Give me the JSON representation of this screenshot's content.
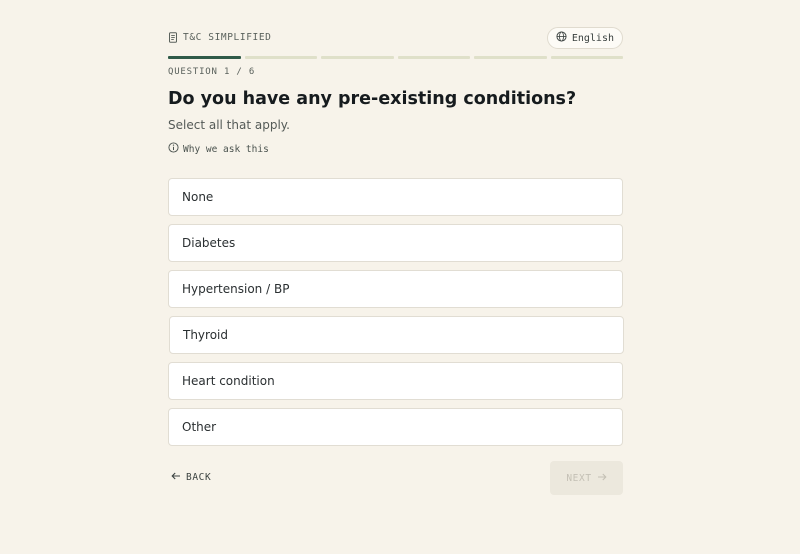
{
  "header": {
    "brand_label": "T&C SIMPLIFIED",
    "brand_icon": "scroll-icon",
    "language_label": "English",
    "language_icon": "globe-icon"
  },
  "progress": {
    "current_step": 1,
    "total_steps": 6
  },
  "question": {
    "counter": "QUESTION 1 / 6",
    "title": "Do you have any pre-existing conditions?",
    "subtitle": "Select all that apply.",
    "why_link": "Why we ask this",
    "why_icon": "info-icon"
  },
  "options": [
    {
      "label": "None"
    },
    {
      "label": "Diabetes"
    },
    {
      "label": "Hypertension / BP"
    },
    {
      "label": "Thyroid"
    },
    {
      "label": "Heart condition"
    },
    {
      "label": "Other"
    }
  ],
  "footer": {
    "back_label": "BACK",
    "back_icon": "arrow-left-icon",
    "next_label": "NEXT",
    "next_icon": "arrow-right-icon",
    "next_disabled": true
  },
  "colors": {
    "background": "#f7f3ea",
    "accent": "#2f5a48",
    "progress_inactive": "#dfe0c9"
  }
}
